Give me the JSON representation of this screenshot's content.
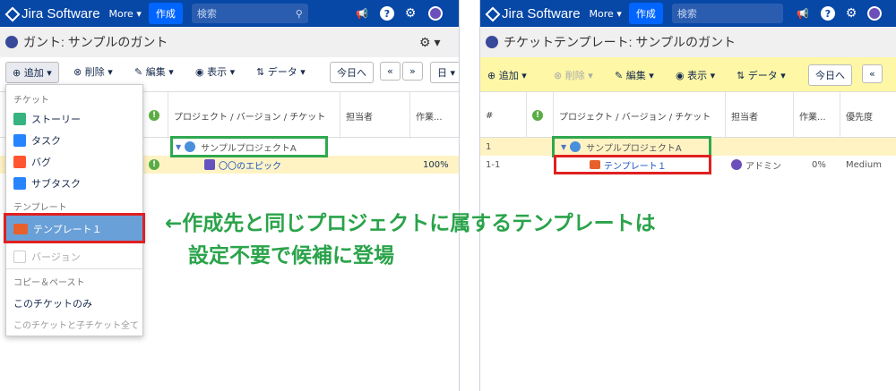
{
  "left": {
    "topbar": {
      "logo": "Jira Software",
      "more": "More ▾",
      "create": "作成",
      "search_placeholder": "検索"
    },
    "title": "ガント: サンプルのガント",
    "toolbar": {
      "add": "追加",
      "delete": "削除",
      "edit": "編集",
      "view": "表示",
      "data": "データ",
      "today": "今日へ",
      "prev": "«",
      "next": "»",
      "day": "日"
    },
    "columns": {
      "project": "プロジェクト / バージョン / チケット",
      "assignee": "担当者",
      "work": "作業..."
    },
    "rows": [
      {
        "name": "サンプルプロジェクトA",
        "work": ""
      },
      {
        "name": "〇〇のエピック",
        "work": "100%"
      }
    ],
    "dropdown": {
      "section_ticket": "チケット",
      "story": "ストーリー",
      "task": "タスク",
      "bug": "バグ",
      "subtask": "サブタスク",
      "section_template": "テンプレート",
      "template1": "テンプレート１",
      "version": "バージョン",
      "copy_paste": "コピー＆ペースト",
      "this_ticket_only": "このチケットのみ",
      "this_and_children": "このチケットと子チケット全て"
    }
  },
  "right": {
    "topbar": {
      "logo": "Jira Software",
      "more": "More ▾",
      "create": "作成",
      "search_placeholder": "検索"
    },
    "title": "チケットテンプレート: サンプルのガント",
    "toolbar": {
      "add": "追加",
      "delete": "削除",
      "edit": "編集",
      "view": "表示",
      "data": "データ",
      "today": "今日へ",
      "prev": "«"
    },
    "columns": {
      "num": "#",
      "project": "プロジェクト / バージョン / チケット",
      "assignee": "担当者",
      "work": "作業...",
      "priority": "優先度"
    },
    "rows": [
      {
        "num": "1",
        "name": "サンプルプロジェクトA",
        "assignee": "",
        "work": "",
        "priority": ""
      },
      {
        "num": "1-1",
        "name": "テンプレート１",
        "assignee": "アドミン",
        "work": "0%",
        "priority": "Medium"
      }
    ]
  },
  "annotation": {
    "line1": "←作成先と同じプロジェクトに属するテンプレートは",
    "line2": "設定不要で候補に登場"
  },
  "colors": {
    "nav": "#0747a6",
    "highlight_row": "#fff3c4",
    "red": "#e02020",
    "green": "#2fa84f",
    "annotation": "#2aa34a"
  }
}
